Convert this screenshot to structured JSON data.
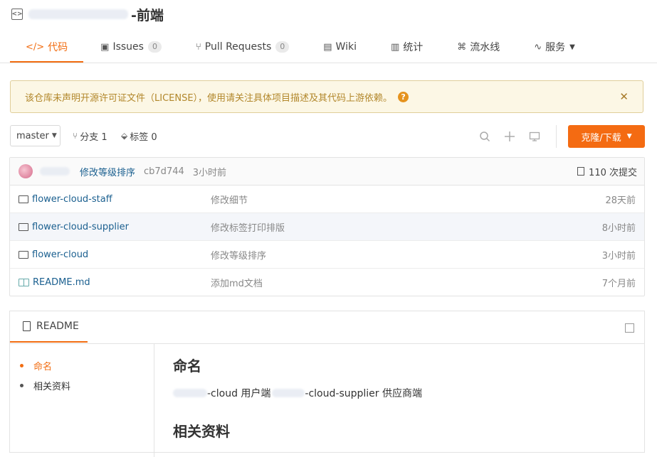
{
  "repo": {
    "title": "-前端"
  },
  "tabs": [
    {
      "label": "代码",
      "icon": "code-icon",
      "active": true
    },
    {
      "label": "Issues",
      "count": "0",
      "icon": "issues-icon"
    },
    {
      "label": "Pull Requests",
      "count": "0",
      "icon": "pull-request-icon"
    },
    {
      "label": "Wiki",
      "icon": "wiki-icon"
    },
    {
      "label": "统计",
      "icon": "chart-icon"
    },
    {
      "label": "流水线",
      "icon": "pipeline-icon"
    },
    {
      "label": "服务",
      "icon": "service-icon"
    }
  ],
  "notice": {
    "text": "该仓库未声明开源许可证文件（LICENSE），使用请关注具体项目描述及其代码上游依赖。",
    "help": "?",
    "close": "✕"
  },
  "toolbar": {
    "branch": "master",
    "branches": "分支 1",
    "tags": "标签 0",
    "clone_label": "克隆/下载"
  },
  "commit": {
    "message": "修改等级排序",
    "hash": "cb7d744",
    "time": "3小时前",
    "count": "110 次提交"
  },
  "files": [
    {
      "name": "flower-cloud-staff",
      "message": "修改细节",
      "time": "28天前",
      "type": "folder"
    },
    {
      "name": "flower-cloud-supplier",
      "message": "修改标签打印排版",
      "time": "8小时前",
      "type": "folder"
    },
    {
      "name": "flower-cloud",
      "message": "修改等级排序",
      "time": "3小时前",
      "type": "folder"
    },
    {
      "name": "README.md",
      "message": "添加md文档",
      "time": "7个月前",
      "type": "file"
    }
  ],
  "readme": {
    "tab_label": "README",
    "toc": [
      "命名",
      "相关资料"
    ],
    "heading1": "命名",
    "para_part1": "-cloud 用户端",
    "para_part2": "-cloud-supplier 供应商端",
    "heading2": "相关资料"
  },
  "colors": {
    "accent": "#f26d12",
    "link": "#1a5f8f",
    "notice_bg": "#fcf7e5"
  }
}
